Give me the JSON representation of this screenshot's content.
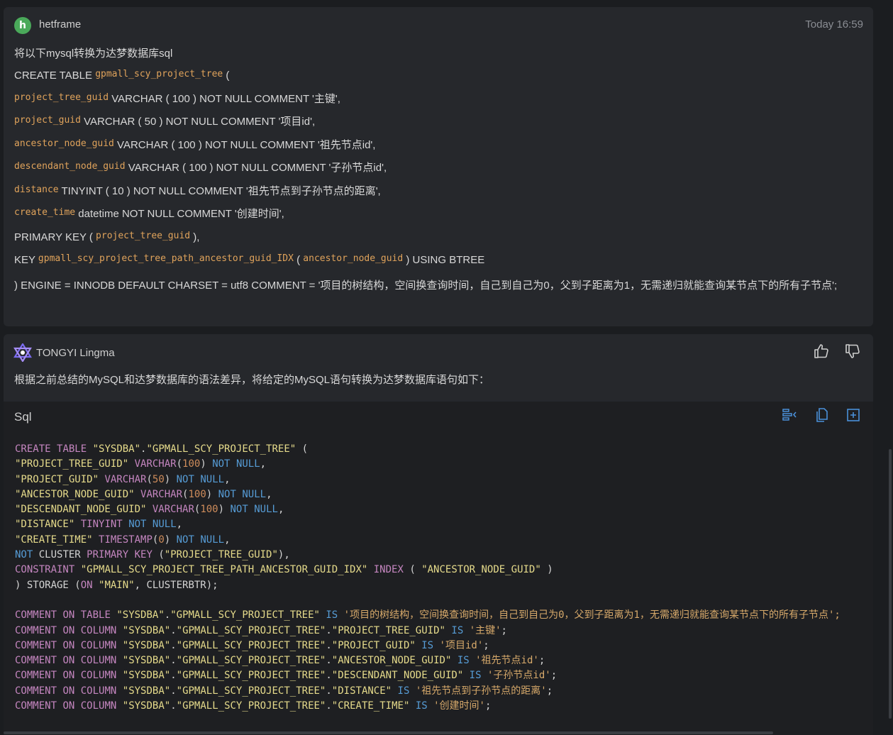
{
  "user_message": {
    "avatar_letter": "h",
    "username": "hetframe",
    "time": "Today 16:59",
    "lines": [
      {
        "parts": [
          {
            "t": "将以下mysql转换为达梦数据库sql"
          }
        ]
      },
      {
        "parts": [
          {
            "t": "CREATE TABLE "
          },
          {
            "c": "gpmall_scy_project_tree"
          },
          {
            "t": " ("
          }
        ]
      },
      {
        "parts": [
          {
            "c": "project_tree_guid"
          },
          {
            "t": " VARCHAR ( 100 ) NOT NULL COMMENT '主键',"
          }
        ]
      },
      {
        "parts": [
          {
            "c": "project_guid"
          },
          {
            "t": " VARCHAR ( 50 ) NOT NULL COMMENT '项目id',"
          }
        ]
      },
      {
        "parts": [
          {
            "c": "ancestor_node_guid"
          },
          {
            "t": " VARCHAR ( 100 ) NOT NULL COMMENT '祖先节点id',"
          }
        ]
      },
      {
        "parts": [
          {
            "c": "descendant_node_guid"
          },
          {
            "t": " VARCHAR ( 100 ) NOT NULL COMMENT '子孙节点id',"
          }
        ]
      },
      {
        "parts": [
          {
            "c": "distance"
          },
          {
            "t": " TINYINT ( 10 ) NOT NULL COMMENT '祖先节点到子孙节点的距离',"
          }
        ]
      },
      {
        "parts": [
          {
            "c": "create_time"
          },
          {
            "t": " datetime NOT NULL COMMENT '创建时间',"
          }
        ]
      },
      {
        "parts": [
          {
            "t": "PRIMARY KEY ( "
          },
          {
            "c": "project_tree_guid"
          },
          {
            "t": " ),"
          }
        ]
      },
      {
        "parts": [
          {
            "t": "KEY "
          },
          {
            "c": "gpmall_scy_project_tree_path_ancestor_guid_IDX"
          },
          {
            "t": " ( "
          },
          {
            "c": "ancestor_node_guid"
          },
          {
            "t": " ) USING BTREE"
          }
        ]
      },
      {
        "wrap": true,
        "parts": [
          {
            "t": ") ENGINE = INNODB DEFAULT CHARSET = utf8 COMMENT = '项目的树结构，空间换查询时间，自己到自己为0，父到子距离为1，无需递归就能查询某节点下的所有子节点';"
          }
        ]
      }
    ]
  },
  "ai_message": {
    "name": "TONGYI Lingma",
    "text": "根据之前总结的MySQL和达梦数据库的语法差异，将给定的MySQL语句转换为达梦数据库语句如下：",
    "like_label": "thumbs-up",
    "dislike_label": "thumbs-down"
  },
  "code_block": {
    "language": "Sql",
    "tools": [
      "insert-icon",
      "copy-icon",
      "new-file-icon"
    ],
    "lines": [
      [
        [
          "kw",
          "CREATE"
        ],
        [
          "p",
          " "
        ],
        [
          "kw",
          "TABLE"
        ],
        [
          "p",
          " "
        ],
        [
          "str",
          "\"SYSDBA\""
        ],
        [
          "p",
          "."
        ],
        [
          "str",
          "\"GPMALL_SCY_PROJECT_TREE\""
        ],
        [
          "p",
          " ("
        ]
      ],
      [
        [
          "p",
          "        "
        ],
        [
          "str",
          "\"PROJECT_TREE_GUID\""
        ],
        [
          "p",
          " "
        ],
        [
          "kw",
          "VARCHAR"
        ],
        [
          "p",
          "("
        ],
        [
          "num",
          "100"
        ],
        [
          "p",
          ") "
        ],
        [
          "kw2",
          "NOT"
        ],
        [
          "p",
          " "
        ],
        [
          "kw2",
          "NULL"
        ],
        [
          "p",
          ","
        ]
      ],
      [
        [
          "p",
          "        "
        ],
        [
          "str",
          "\"PROJECT_GUID\""
        ],
        [
          "p",
          " "
        ],
        [
          "kw",
          "VARCHAR"
        ],
        [
          "p",
          "("
        ],
        [
          "num",
          "50"
        ],
        [
          "p",
          ") "
        ],
        [
          "kw2",
          "NOT"
        ],
        [
          "p",
          " "
        ],
        [
          "kw2",
          "NULL"
        ],
        [
          "p",
          ","
        ]
      ],
      [
        [
          "p",
          "        "
        ],
        [
          "str",
          "\"ANCESTOR_NODE_GUID\""
        ],
        [
          "p",
          " "
        ],
        [
          "kw",
          "VARCHAR"
        ],
        [
          "p",
          "("
        ],
        [
          "num",
          "100"
        ],
        [
          "p",
          ") "
        ],
        [
          "kw2",
          "NOT"
        ],
        [
          "p",
          " "
        ],
        [
          "kw2",
          "NULL"
        ],
        [
          "p",
          ","
        ]
      ],
      [
        [
          "p",
          "        "
        ],
        [
          "str",
          "\"DESCENDANT_NODE_GUID\""
        ],
        [
          "p",
          " "
        ],
        [
          "kw",
          "VARCHAR"
        ],
        [
          "p",
          "("
        ],
        [
          "num",
          "100"
        ],
        [
          "p",
          ") "
        ],
        [
          "kw2",
          "NOT"
        ],
        [
          "p",
          " "
        ],
        [
          "kw2",
          "NULL"
        ],
        [
          "p",
          ","
        ]
      ],
      [
        [
          "p",
          "        "
        ],
        [
          "str",
          "\"DISTANCE\""
        ],
        [
          "p",
          " "
        ],
        [
          "kw",
          "TINYINT"
        ],
        [
          "p",
          " "
        ],
        [
          "kw2",
          "NOT"
        ],
        [
          "p",
          " "
        ],
        [
          "kw2",
          "NULL"
        ],
        [
          "p",
          ","
        ]
      ],
      [
        [
          "p",
          "        "
        ],
        [
          "str",
          "\"CREATE_TIME\""
        ],
        [
          "p",
          " "
        ],
        [
          "kw",
          "TIMESTAMP"
        ],
        [
          "p",
          "("
        ],
        [
          "num",
          "0"
        ],
        [
          "p",
          ") "
        ],
        [
          "kw2",
          "NOT"
        ],
        [
          "p",
          " "
        ],
        [
          "kw2",
          "NULL"
        ],
        [
          "p",
          ","
        ]
      ],
      [
        [
          "p",
          "        "
        ],
        [
          "kw2",
          "NOT"
        ],
        [
          "p",
          " CLUSTER "
        ],
        [
          "kw",
          "PRIMARY"
        ],
        [
          "p",
          " "
        ],
        [
          "kw",
          "KEY"
        ],
        [
          "p",
          " ("
        ],
        [
          "str",
          "\"PROJECT_TREE_GUID\""
        ],
        [
          "p",
          "),"
        ]
      ],
      [
        [
          "p",
          "        "
        ],
        [
          "kw",
          "CONSTRAINT"
        ],
        [
          "p",
          " "
        ],
        [
          "str",
          "\"GPMALL_SCY_PROJECT_TREE_PATH_ANCESTOR_GUID_IDX\""
        ],
        [
          "p",
          " "
        ],
        [
          "kw",
          "INDEX"
        ],
        [
          "p",
          " ( "
        ],
        [
          "str",
          "\"ANCESTOR_NODE_GUID\""
        ],
        [
          "p",
          " )"
        ]
      ],
      [
        [
          "p",
          ") STORAGE ("
        ],
        [
          "kw",
          "ON"
        ],
        [
          "p",
          " "
        ],
        [
          "str",
          "\"MAIN\""
        ],
        [
          "p",
          ", CLUSTERBTR);"
        ]
      ],
      [
        [
          "p",
          ""
        ]
      ],
      [
        [
          "kw",
          "COMMENT"
        ],
        [
          "p",
          " "
        ],
        [
          "kw",
          "ON"
        ],
        [
          "p",
          " "
        ],
        [
          "kw",
          "TABLE"
        ],
        [
          "p",
          " "
        ],
        [
          "str",
          "\"SYSDBA\""
        ],
        [
          "p",
          "."
        ],
        [
          "str",
          "\"GPMALL_SCY_PROJECT_TREE\""
        ],
        [
          "p",
          " "
        ],
        [
          "kw2",
          "IS"
        ],
        [
          "p",
          " "
        ],
        [
          "cs",
          "'项目的树结构，空间换查询时间，自己到自己为0，父到子距离为1，无需递归就能查询某节点下的所有子节点';"
        ]
      ],
      [
        [
          "kw",
          "COMMENT"
        ],
        [
          "p",
          " "
        ],
        [
          "kw",
          "ON"
        ],
        [
          "p",
          " "
        ],
        [
          "kw",
          "COLUMN"
        ],
        [
          "p",
          " "
        ],
        [
          "str",
          "\"SYSDBA\""
        ],
        [
          "p",
          "."
        ],
        [
          "str",
          "\"GPMALL_SCY_PROJECT_TREE\""
        ],
        [
          "p",
          "."
        ],
        [
          "str",
          "\"PROJECT_TREE_GUID\""
        ],
        [
          "p",
          " "
        ],
        [
          "kw2",
          "IS"
        ],
        [
          "p",
          " "
        ],
        [
          "cs",
          "'主键'"
        ],
        [
          "p",
          ";"
        ]
      ],
      [
        [
          "kw",
          "COMMENT"
        ],
        [
          "p",
          " "
        ],
        [
          "kw",
          "ON"
        ],
        [
          "p",
          " "
        ],
        [
          "kw",
          "COLUMN"
        ],
        [
          "p",
          " "
        ],
        [
          "str",
          "\"SYSDBA\""
        ],
        [
          "p",
          "."
        ],
        [
          "str",
          "\"GPMALL_SCY_PROJECT_TREE\""
        ],
        [
          "p",
          "."
        ],
        [
          "str",
          "\"PROJECT_GUID\""
        ],
        [
          "p",
          " "
        ],
        [
          "kw2",
          "IS"
        ],
        [
          "p",
          " "
        ],
        [
          "cs",
          "'项目id'"
        ],
        [
          "p",
          ";"
        ]
      ],
      [
        [
          "kw",
          "COMMENT"
        ],
        [
          "p",
          " "
        ],
        [
          "kw",
          "ON"
        ],
        [
          "p",
          " "
        ],
        [
          "kw",
          "COLUMN"
        ],
        [
          "p",
          " "
        ],
        [
          "str",
          "\"SYSDBA\""
        ],
        [
          "p",
          "."
        ],
        [
          "str",
          "\"GPMALL_SCY_PROJECT_TREE\""
        ],
        [
          "p",
          "."
        ],
        [
          "str",
          "\"ANCESTOR_NODE_GUID\""
        ],
        [
          "p",
          " "
        ],
        [
          "kw2",
          "IS"
        ],
        [
          "p",
          " "
        ],
        [
          "cs",
          "'祖先节点id'"
        ],
        [
          "p",
          ";"
        ]
      ],
      [
        [
          "kw",
          "COMMENT"
        ],
        [
          "p",
          " "
        ],
        [
          "kw",
          "ON"
        ],
        [
          "p",
          " "
        ],
        [
          "kw",
          "COLUMN"
        ],
        [
          "p",
          " "
        ],
        [
          "str",
          "\"SYSDBA\""
        ],
        [
          "p",
          "."
        ],
        [
          "str",
          "\"GPMALL_SCY_PROJECT_TREE\""
        ],
        [
          "p",
          "."
        ],
        [
          "str",
          "\"DESCENDANT_NODE_GUID\""
        ],
        [
          "p",
          " "
        ],
        [
          "kw2",
          "IS"
        ],
        [
          "p",
          " "
        ],
        [
          "cs",
          "'子孙节点id'"
        ],
        [
          "p",
          ";"
        ]
      ],
      [
        [
          "kw",
          "COMMENT"
        ],
        [
          "p",
          " "
        ],
        [
          "kw",
          "ON"
        ],
        [
          "p",
          " "
        ],
        [
          "kw",
          "COLUMN"
        ],
        [
          "p",
          " "
        ],
        [
          "str",
          "\"SYSDBA\""
        ],
        [
          "p",
          "."
        ],
        [
          "str",
          "\"GPMALL_SCY_PROJECT_TREE\""
        ],
        [
          "p",
          "."
        ],
        [
          "str",
          "\"DISTANCE\""
        ],
        [
          "p",
          " "
        ],
        [
          "kw2",
          "IS"
        ],
        [
          "p",
          " "
        ],
        [
          "cs",
          "'祖先节点到子孙节点的距离'"
        ],
        [
          "p",
          ";"
        ]
      ],
      [
        [
          "kw",
          "COMMENT"
        ],
        [
          "p",
          " "
        ],
        [
          "kw",
          "ON"
        ],
        [
          "p",
          " "
        ],
        [
          "kw",
          "COLUMN"
        ],
        [
          "p",
          " "
        ],
        [
          "str",
          "\"SYSDBA\""
        ],
        [
          "p",
          "."
        ],
        [
          "str",
          "\"GPMALL_SCY_PROJECT_TREE\""
        ],
        [
          "p",
          "."
        ],
        [
          "str",
          "\"CREATE_TIME\""
        ],
        [
          "p",
          " "
        ],
        [
          "kw2",
          "IS"
        ],
        [
          "p",
          " "
        ],
        [
          "cs",
          "'创建时间'"
        ],
        [
          "p",
          ";"
        ]
      ]
    ]
  },
  "colors": {
    "avatar": "#4aa95a",
    "inline_code": "#e0a35b",
    "keyword": "#c586c0",
    "keyword2": "#569cd6",
    "string": "#e6db8b",
    "number": "#ce8c5b",
    "accent_icon": "#4a90d9"
  }
}
